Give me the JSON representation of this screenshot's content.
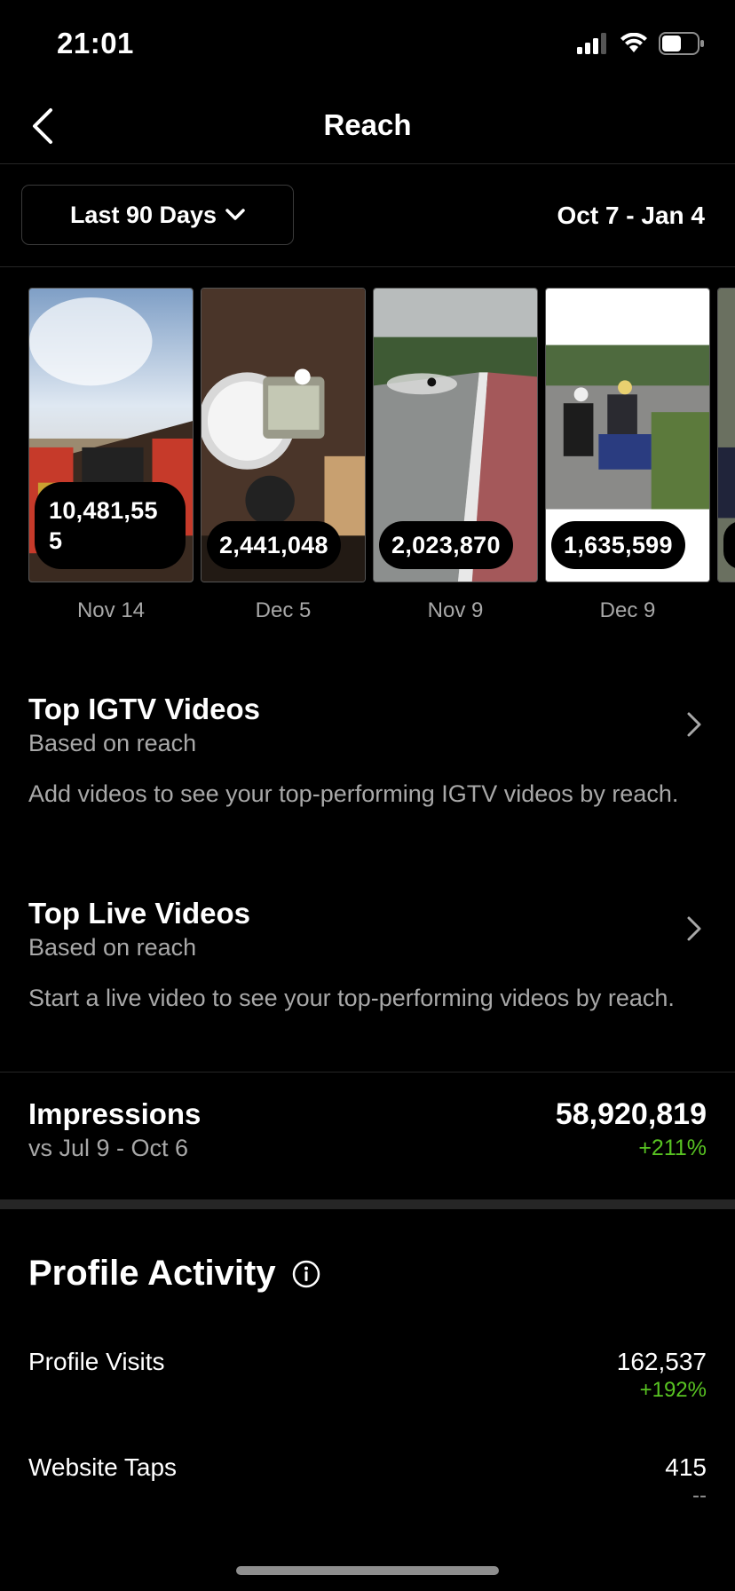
{
  "status": {
    "time": "21:01",
    "battery_icon": "battery-icon",
    "wifi_icon": "wifi-icon",
    "signal_icon": "signal-icon"
  },
  "nav": {
    "title": "Reach",
    "back_icon": "chevron-left-icon"
  },
  "filter": {
    "range_label": "Last 90 Days",
    "dropdown_icon": "chevron-down-icon",
    "date_range": "Oct 7 - Jan 4"
  },
  "posts": [
    {
      "reach": "10,481,555",
      "date": "Nov 14"
    },
    {
      "reach": "2,441,048",
      "date": "Dec 5"
    },
    {
      "reach": "2,023,870",
      "date": "Nov 9"
    },
    {
      "reach": "1,635,599",
      "date": "Dec 9"
    }
  ],
  "igtv": {
    "title": "Top IGTV Videos",
    "subtitle": "Based on reach",
    "description": "Add videos to see your top-performing IGTV videos by reach."
  },
  "live": {
    "title": "Top Live Videos",
    "subtitle": "Based on reach",
    "description": "Start a live video to see your top-performing videos by reach."
  },
  "impressions": {
    "label": "Impressions",
    "comparison": "vs Jul 9 - Oct 6",
    "value": "58,920,819",
    "change": "+211%"
  },
  "profile_activity": {
    "title": "Profile Activity",
    "info_icon": "info-icon",
    "metrics": [
      {
        "label": "Profile Visits",
        "value": "162,537",
        "change": "+192%"
      },
      {
        "label": "Website Taps",
        "value": "415",
        "change": "--"
      }
    ]
  },
  "colors": {
    "background": "#000000",
    "positive": "#58c322",
    "secondary_text": "#a8a8a8",
    "divider": "#262626"
  }
}
